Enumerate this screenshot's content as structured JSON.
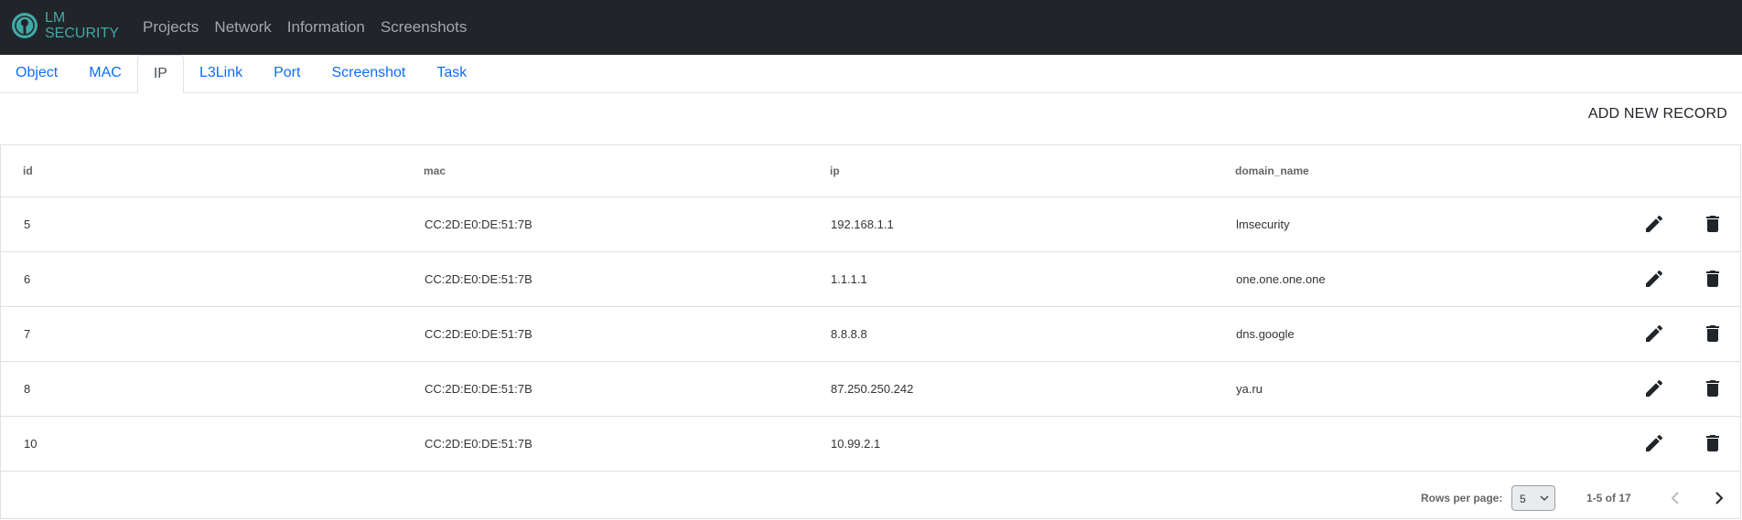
{
  "brand": {
    "line1": "LM",
    "line2": "SECURITY"
  },
  "nav": [
    "Projects",
    "Network",
    "Information",
    "Screenshots"
  ],
  "tabs": [
    {
      "label": "Object",
      "active": false
    },
    {
      "label": "MAC",
      "active": false
    },
    {
      "label": "IP",
      "active": true
    },
    {
      "label": "L3Link",
      "active": false
    },
    {
      "label": "Port",
      "active": false
    },
    {
      "label": "Screenshot",
      "active": false
    },
    {
      "label": "Task",
      "active": false
    }
  ],
  "add_button": "ADD NEW RECORD",
  "table": {
    "columns": [
      "id",
      "mac",
      "ip",
      "domain_name"
    ],
    "rows": [
      {
        "id": "5",
        "mac": "CC:2D:E0:DE:51:7B",
        "ip": "192.168.1.1",
        "domain_name": "lmsecurity"
      },
      {
        "id": "6",
        "mac": "CC:2D:E0:DE:51:7B",
        "ip": "1.1.1.1",
        "domain_name": "one.one.one.one"
      },
      {
        "id": "7",
        "mac": "CC:2D:E0:DE:51:7B",
        "ip": "8.8.8.8",
        "domain_name": "dns.google"
      },
      {
        "id": "8",
        "mac": "CC:2D:E0:DE:51:7B",
        "ip": "87.250.250.242",
        "domain_name": "ya.ru"
      },
      {
        "id": "10",
        "mac": "CC:2D:E0:DE:51:7B",
        "ip": "10.99.2.1",
        "domain_name": ""
      }
    ]
  },
  "pagination": {
    "rows_per_page_label": "Rows per page:",
    "rows_per_page": "5",
    "range": "1-5 of 17"
  },
  "icons": {
    "edit": "pencil-icon",
    "delete": "trash-icon",
    "prev": "chevron-left-icon",
    "next": "chevron-right-icon"
  },
  "colors": {
    "navbar_bg": "#212529",
    "brand": "#3fa9a6",
    "link": "#0d6efd"
  }
}
